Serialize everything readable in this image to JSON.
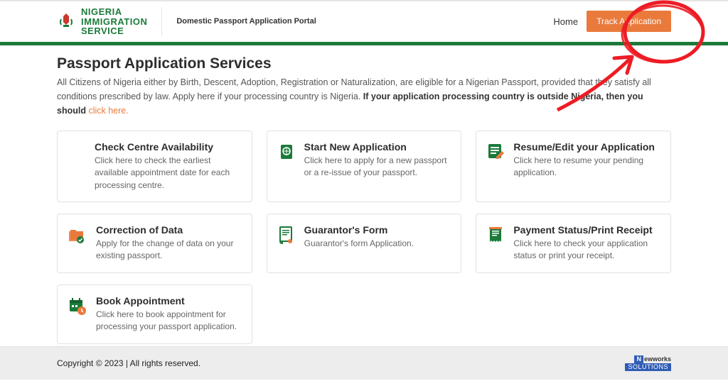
{
  "header": {
    "org_line1": "NIGERIA",
    "org_line2": "IMMIGRATION",
    "org_line3": "SERVICE",
    "portal_label": "Domestic Passport Application Portal",
    "nav_home": "Home",
    "track_button": "Track Application"
  },
  "main": {
    "title": "Passport Application Services",
    "intro_pre": "All Citizens of Nigeria either by Birth, Descent, Adoption, Registration or Naturalization, are eligible for a Nigerian Passport, provided that they satisfy all conditions prescribed by law. Apply here if your processing country is Nigeria. ",
    "intro_bold": "If your application processing country is outside Nigeria, then you should ",
    "intro_link": "click here."
  },
  "cards": [
    {
      "title": "Check Centre Availability",
      "desc": "Click here to check the earliest available appointment date for each processing centre."
    },
    {
      "title": "Start New Application",
      "desc": "Click here to apply for a new passport or a re-issue of your passport."
    },
    {
      "title": "Resume/Edit your Application",
      "desc": "Click here to resume your pending application."
    },
    {
      "title": "Correction of Data",
      "desc": "Apply for the change of data on your existing passport."
    },
    {
      "title": "Guarantor's Form",
      "desc": "Guarantor's form Application."
    },
    {
      "title": "Payment Status/Print Receipt",
      "desc": "Click here to check your application status or print your receipt."
    },
    {
      "title": "Book Appointment",
      "desc": "Click here to book appointment for processing your passport application."
    }
  ],
  "footer": {
    "copyright": "Copyright © 2023 | All rights reserved.",
    "vendor_top": "ewworks",
    "vendor_n": "N",
    "vendor_bottom": "SOLUTIONS"
  },
  "colors": {
    "accent_green": "#1b7a3a",
    "accent_orange": "#e97a3c"
  }
}
